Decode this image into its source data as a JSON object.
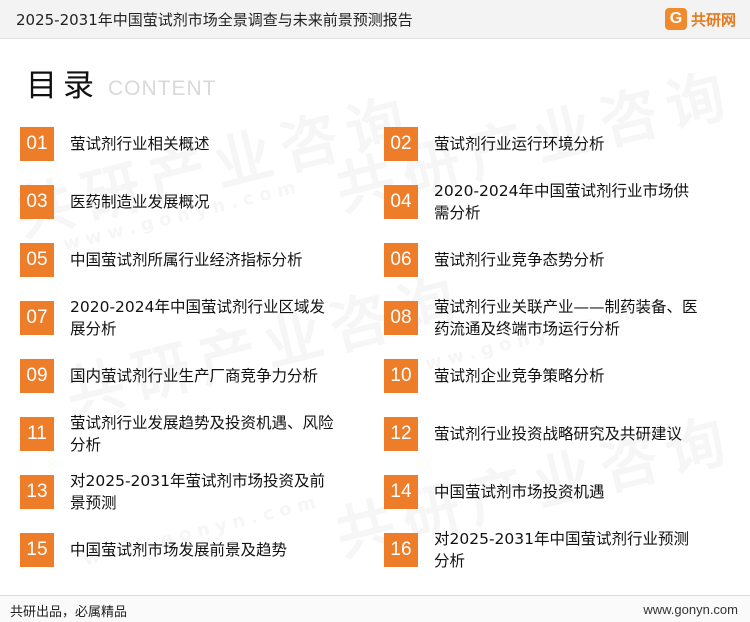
{
  "header": {
    "title": "2025-2031年中国萤试剂市场全景调查与未来前景预测报告",
    "logo_icon": "gonyn-logo-icon",
    "logo_text": "共研网",
    "accent_color": "#ee7d2a"
  },
  "heading": {
    "main": "目录",
    "sub": "CONTENT"
  },
  "watermark": {
    "main": "共研产业咨询",
    "site": "www.gonyn.com"
  },
  "toc": [
    {
      "num": "01",
      "title": "萤试剂行业相关概述"
    },
    {
      "num": "02",
      "title": "萤试剂行业运行环境分析"
    },
    {
      "num": "03",
      "title": "医药制造业发展概况"
    },
    {
      "num": "04",
      "title": "2020-2024年中国萤试剂行业市场供需分析"
    },
    {
      "num": "05",
      "title": "中国萤试剂所属行业经济指标分析"
    },
    {
      "num": "06",
      "title": "萤试剂行业竞争态势分析"
    },
    {
      "num": "07",
      "title": "2020-2024年中国萤试剂行业区域发展分析"
    },
    {
      "num": "08",
      "title": "萤试剂行业关联产业——制药装备、医药流通及终端市场运行分析"
    },
    {
      "num": "09",
      "title": "国内萤试剂行业生产厂商竞争力分析"
    },
    {
      "num": "10",
      "title": "萤试剂企业竞争策略分析"
    },
    {
      "num": "11",
      "title": "萤试剂行业发展趋势及投资机遇、风险分析"
    },
    {
      "num": "12",
      "title": "萤试剂行业投资战略研究及共研建议"
    },
    {
      "num": "13",
      "title": "对2025-2031年萤试剂市场投资及前景预测"
    },
    {
      "num": "14",
      "title": "中国萤试剂市场投资机遇"
    },
    {
      "num": "15",
      "title": "中国萤试剂市场发展前景及趋势"
    },
    {
      "num": "16",
      "title": "对2025-2031年中国萤试剂行业预测分析"
    }
  ],
  "footer": {
    "slogan": "共研出品，必属精品",
    "url": "www.gonyn.com"
  }
}
